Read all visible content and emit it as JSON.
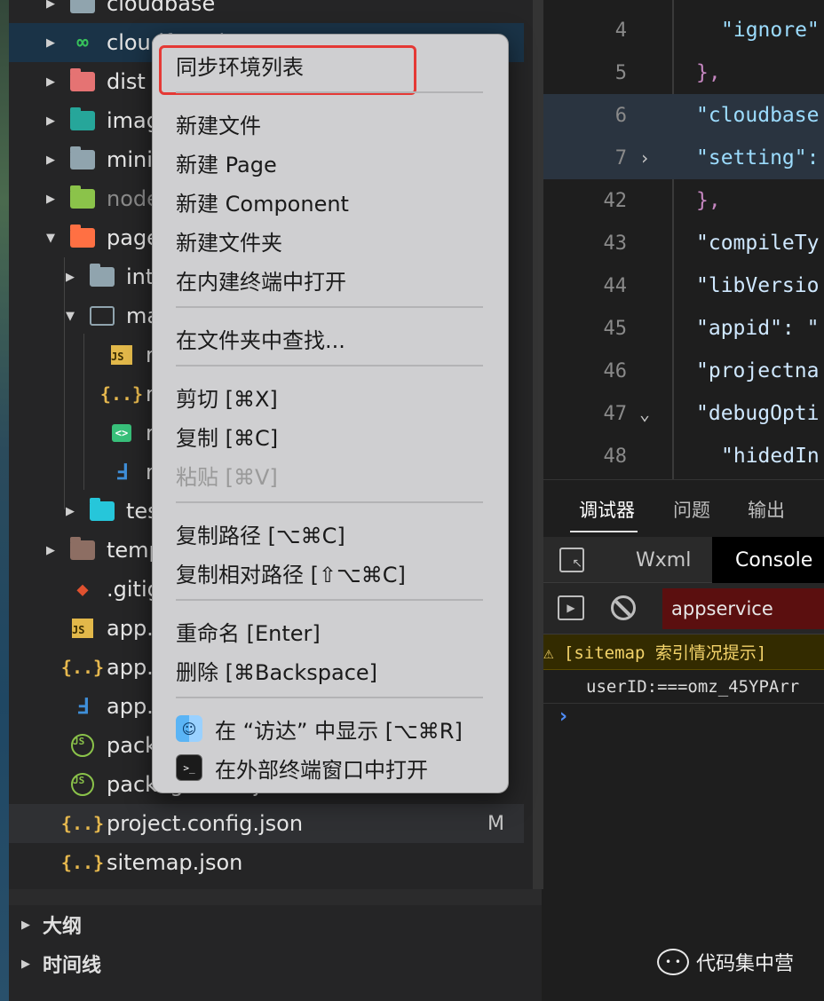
{
  "explorer": {
    "rows": [
      {
        "name": "cloudbase",
        "twisty": "▶",
        "icon": "folder",
        "color": "#90a4ae"
      },
      {
        "name": "cloudfunctions",
        "twisty": "▶",
        "icon": "cloud",
        "color": "#37c15b"
      },
      {
        "name": "dist",
        "twisty": "▶",
        "icon": "folder",
        "color": "#e57373"
      },
      {
        "name": "images",
        "twisty": "▶",
        "icon": "folder",
        "color": "#26a69a"
      },
      {
        "name": "miniprogram_npm",
        "twisty": "▶",
        "icon": "folder",
        "color": "#90a4ae"
      },
      {
        "name": "node_modules",
        "twisty": "▶",
        "icon": "folder",
        "color": "#8bc34a"
      },
      {
        "name": "pages",
        "twisty": "▼",
        "icon": "folder",
        "color": "#ff7043"
      },
      {
        "name": "intro",
        "twisty": "▶",
        "icon": "folder",
        "color": "#90a4ae"
      },
      {
        "name": "main",
        "twisty": "▼",
        "icon": "folder-open",
        "color": "#90a4ae"
      },
      {
        "name": "main.js",
        "twisty": "",
        "icon": "js",
        "color": "#e2b84a"
      },
      {
        "name": "main.json",
        "twisty": "",
        "icon": "json",
        "color": "#e6b84e"
      },
      {
        "name": "main.wxml",
        "twisty": "",
        "icon": "wxml",
        "color": "#38c07a"
      },
      {
        "name": "main.wxss",
        "twisty": "",
        "icon": "css",
        "color": "#3f8fd9"
      },
      {
        "name": "test",
        "twisty": "▶",
        "icon": "folder",
        "color": "#26c6da"
      },
      {
        "name": "templates",
        "twisty": "▶",
        "icon": "folder",
        "color": "#8d6e63"
      },
      {
        "name": ".gitignore",
        "twisty": "",
        "icon": "git",
        "color": "#e0512f"
      },
      {
        "name": "app.js",
        "twisty": "",
        "icon": "js",
        "color": "#e2b84a"
      },
      {
        "name": "app.json",
        "twisty": "",
        "icon": "json",
        "color": "#e6b84e"
      },
      {
        "name": "app.wxss",
        "twisty": "",
        "icon": "css",
        "color": "#3f8fd9"
      },
      {
        "name": "package.json",
        "twisty": "",
        "icon": "node",
        "color": "#8bc34a"
      },
      {
        "name": "package-lock.json",
        "twisty": "",
        "icon": "node",
        "color": "#8bc34a"
      },
      {
        "name": "project.config.json",
        "twisty": "",
        "icon": "json",
        "color": "#e6b84e",
        "badge": "M"
      },
      {
        "name": "sitemap.json",
        "twisty": "",
        "icon": "json",
        "color": "#e6b84e"
      }
    ],
    "sections": [
      {
        "label": "大纲",
        "twisty": "▶"
      },
      {
        "label": "时间线",
        "twisty": "▶"
      }
    ]
  },
  "editor": {
    "lines": [
      {
        "no": "4",
        "text": "\"ignore\"",
        "kind": "str",
        "indent": 2
      },
      {
        "no": "5",
        "text": "},",
        "kind": "punc",
        "indent": 1
      },
      {
        "no": "6",
        "text": "\"cloudbase",
        "kind": "str",
        "indent": 1
      },
      {
        "no": "7",
        "text": "\"setting\":",
        "kind": "str",
        "indent": 1,
        "fold": "›"
      },
      {
        "no": "42",
        "text": "},",
        "kind": "punc",
        "indent": 1
      },
      {
        "no": "43",
        "text": "\"compileTy",
        "kind": "str2",
        "indent": 1
      },
      {
        "no": "44",
        "text": "\"libVersio",
        "kind": "str2",
        "indent": 1
      },
      {
        "no": "45",
        "text": "\"appid\": \"",
        "kind": "str2",
        "indent": 1
      },
      {
        "no": "46",
        "text": "\"projectna",
        "kind": "str2",
        "indent": 1
      },
      {
        "no": "47",
        "text": "\"debugOpti",
        "kind": "str2",
        "indent": 1,
        "fold": "⌄"
      },
      {
        "no": "48",
        "text": "\"hidedIn",
        "kind": "str2",
        "indent": 2
      }
    ]
  },
  "debug": {
    "tabs": [
      "调试器",
      "问题",
      "输出"
    ],
    "devtools_tabs": [
      "Wxml",
      "Console"
    ],
    "context": "appservice",
    "warning": "⚠ [sitemap 索引情况提示]",
    "log": "userID:===omz_45YPArr",
    "prompt": "›"
  },
  "context_menu": {
    "groups": [
      [
        "同步环境列表"
      ],
      [
        "新建文件",
        "新建 Page",
        "新建 Component",
        "新建文件夹",
        "在内建终端中打开"
      ],
      [
        "在文件夹中查找..."
      ],
      [
        "剪切 [⌘X]",
        "复制 [⌘C]",
        "粘贴 [⌘V]"
      ],
      [
        "复制路径 [⌥⌘C]",
        "复制相对路径 [⇧⌥⌘C]"
      ],
      [
        "重命名 [Enter]",
        "删除 [⌘Backspace]"
      ],
      [
        "在 “访达” 中显示 [⌥⌘R]",
        "在外部终端窗口中打开"
      ]
    ],
    "disabled": [
      "粘贴 [⌘V]"
    ]
  },
  "watermark": "代码集中营",
  "colors": {
    "accent": "#3b7bc0",
    "highlight_box": "#e53935",
    "selected_row": "#1a3347"
  }
}
